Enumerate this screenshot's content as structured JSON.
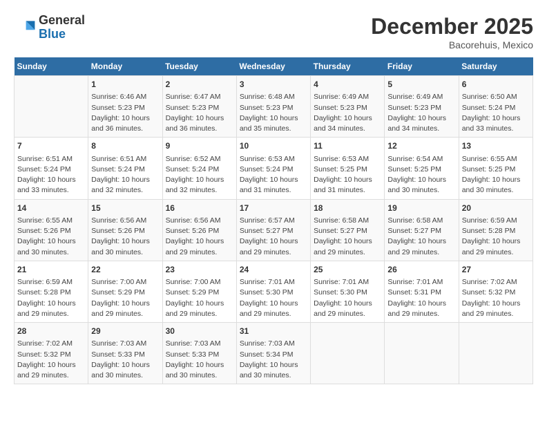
{
  "header": {
    "logo_general": "General",
    "logo_blue": "Blue",
    "month_year": "December 2025",
    "location": "Bacorehuis, Mexico"
  },
  "weekdays": [
    "Sunday",
    "Monday",
    "Tuesday",
    "Wednesday",
    "Thursday",
    "Friday",
    "Saturday"
  ],
  "weeks": [
    [
      {
        "day": "",
        "info": ""
      },
      {
        "day": "1",
        "info": "Sunrise: 6:46 AM\nSunset: 5:23 PM\nDaylight: 10 hours\nand 36 minutes."
      },
      {
        "day": "2",
        "info": "Sunrise: 6:47 AM\nSunset: 5:23 PM\nDaylight: 10 hours\nand 36 minutes."
      },
      {
        "day": "3",
        "info": "Sunrise: 6:48 AM\nSunset: 5:23 PM\nDaylight: 10 hours\nand 35 minutes."
      },
      {
        "day": "4",
        "info": "Sunrise: 6:49 AM\nSunset: 5:23 PM\nDaylight: 10 hours\nand 34 minutes."
      },
      {
        "day": "5",
        "info": "Sunrise: 6:49 AM\nSunset: 5:23 PM\nDaylight: 10 hours\nand 34 minutes."
      },
      {
        "day": "6",
        "info": "Sunrise: 6:50 AM\nSunset: 5:24 PM\nDaylight: 10 hours\nand 33 minutes."
      }
    ],
    [
      {
        "day": "7",
        "info": "Sunrise: 6:51 AM\nSunset: 5:24 PM\nDaylight: 10 hours\nand 33 minutes."
      },
      {
        "day": "8",
        "info": "Sunrise: 6:51 AM\nSunset: 5:24 PM\nDaylight: 10 hours\nand 32 minutes."
      },
      {
        "day": "9",
        "info": "Sunrise: 6:52 AM\nSunset: 5:24 PM\nDaylight: 10 hours\nand 32 minutes."
      },
      {
        "day": "10",
        "info": "Sunrise: 6:53 AM\nSunset: 5:24 PM\nDaylight: 10 hours\nand 31 minutes."
      },
      {
        "day": "11",
        "info": "Sunrise: 6:53 AM\nSunset: 5:25 PM\nDaylight: 10 hours\nand 31 minutes."
      },
      {
        "day": "12",
        "info": "Sunrise: 6:54 AM\nSunset: 5:25 PM\nDaylight: 10 hours\nand 30 minutes."
      },
      {
        "day": "13",
        "info": "Sunrise: 6:55 AM\nSunset: 5:25 PM\nDaylight: 10 hours\nand 30 minutes."
      }
    ],
    [
      {
        "day": "14",
        "info": "Sunrise: 6:55 AM\nSunset: 5:26 PM\nDaylight: 10 hours\nand 30 minutes."
      },
      {
        "day": "15",
        "info": "Sunrise: 6:56 AM\nSunset: 5:26 PM\nDaylight: 10 hours\nand 30 minutes."
      },
      {
        "day": "16",
        "info": "Sunrise: 6:56 AM\nSunset: 5:26 PM\nDaylight: 10 hours\nand 29 minutes."
      },
      {
        "day": "17",
        "info": "Sunrise: 6:57 AM\nSunset: 5:27 PM\nDaylight: 10 hours\nand 29 minutes."
      },
      {
        "day": "18",
        "info": "Sunrise: 6:58 AM\nSunset: 5:27 PM\nDaylight: 10 hours\nand 29 minutes."
      },
      {
        "day": "19",
        "info": "Sunrise: 6:58 AM\nSunset: 5:27 PM\nDaylight: 10 hours\nand 29 minutes."
      },
      {
        "day": "20",
        "info": "Sunrise: 6:59 AM\nSunset: 5:28 PM\nDaylight: 10 hours\nand 29 minutes."
      }
    ],
    [
      {
        "day": "21",
        "info": "Sunrise: 6:59 AM\nSunset: 5:28 PM\nDaylight: 10 hours\nand 29 minutes."
      },
      {
        "day": "22",
        "info": "Sunrise: 7:00 AM\nSunset: 5:29 PM\nDaylight: 10 hours\nand 29 minutes."
      },
      {
        "day": "23",
        "info": "Sunrise: 7:00 AM\nSunset: 5:29 PM\nDaylight: 10 hours\nand 29 minutes."
      },
      {
        "day": "24",
        "info": "Sunrise: 7:01 AM\nSunset: 5:30 PM\nDaylight: 10 hours\nand 29 minutes."
      },
      {
        "day": "25",
        "info": "Sunrise: 7:01 AM\nSunset: 5:30 PM\nDaylight: 10 hours\nand 29 minutes."
      },
      {
        "day": "26",
        "info": "Sunrise: 7:01 AM\nSunset: 5:31 PM\nDaylight: 10 hours\nand 29 minutes."
      },
      {
        "day": "27",
        "info": "Sunrise: 7:02 AM\nSunset: 5:32 PM\nDaylight: 10 hours\nand 29 minutes."
      }
    ],
    [
      {
        "day": "28",
        "info": "Sunrise: 7:02 AM\nSunset: 5:32 PM\nDaylight: 10 hours\nand 29 minutes."
      },
      {
        "day": "29",
        "info": "Sunrise: 7:03 AM\nSunset: 5:33 PM\nDaylight: 10 hours\nand 30 minutes."
      },
      {
        "day": "30",
        "info": "Sunrise: 7:03 AM\nSunset: 5:33 PM\nDaylight: 10 hours\nand 30 minutes."
      },
      {
        "day": "31",
        "info": "Sunrise: 7:03 AM\nSunset: 5:34 PM\nDaylight: 10 hours\nand 30 minutes."
      },
      {
        "day": "",
        "info": ""
      },
      {
        "day": "",
        "info": ""
      },
      {
        "day": "",
        "info": ""
      }
    ]
  ]
}
